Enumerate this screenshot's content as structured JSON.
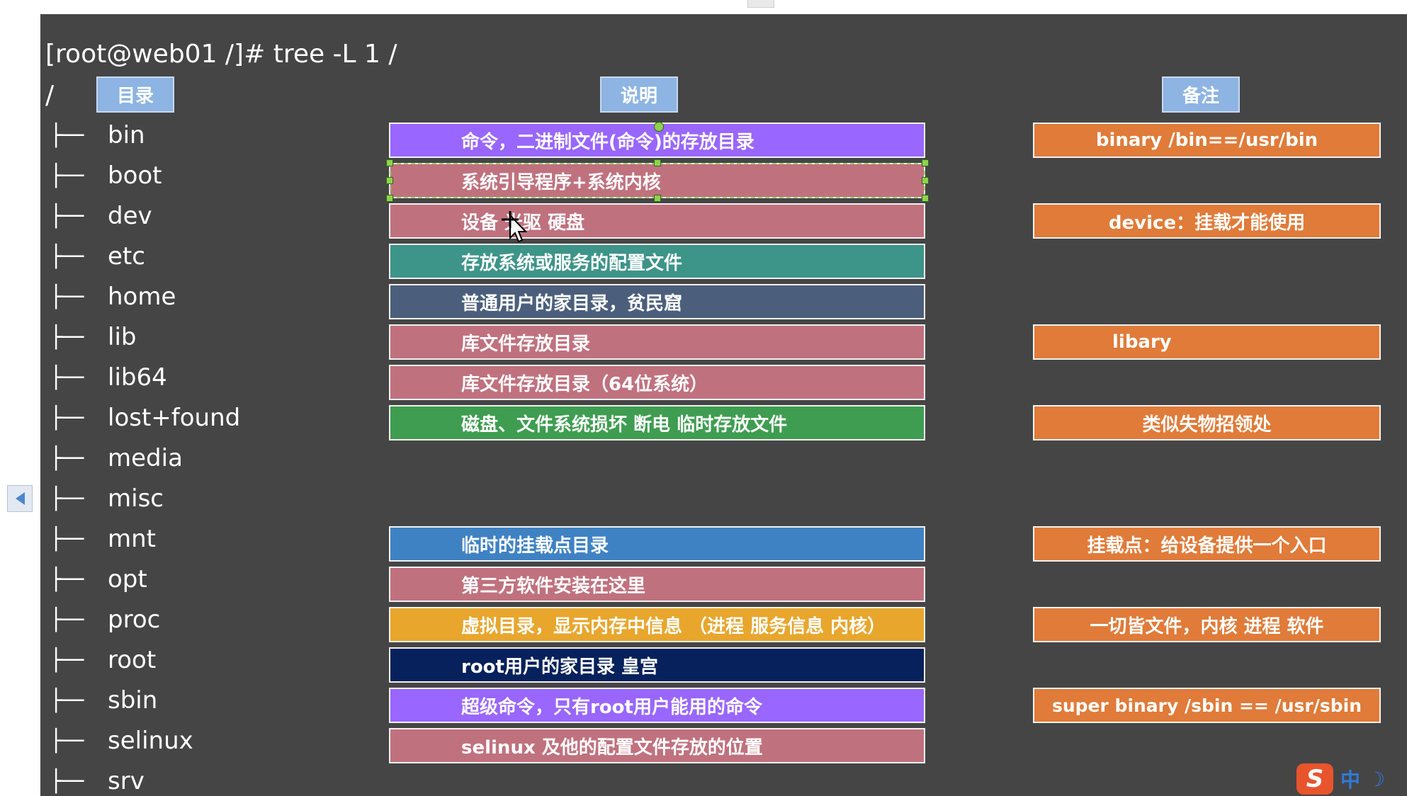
{
  "command": "[root@web01 /]# tree -L 1 /",
  "root": "/",
  "headers": {
    "dir": "目录",
    "desc": "说明",
    "note": "备注"
  },
  "tree_branch": "├──",
  "tree": [
    "bin",
    "boot",
    "dev",
    "etc",
    "home",
    "lib",
    "lib64",
    "lost+found",
    "media",
    "misc",
    "mnt",
    "opt",
    "proc",
    "root",
    "sbin",
    "selinux",
    "srv"
  ],
  "descriptions": [
    {
      "text": "命令，二进制文件(命令)的存放目录",
      "color": "#9966ff"
    },
    {
      "text": "系统引导程序+系统内核",
      "color": "#c0717e"
    },
    {
      "text": "设备 光驱 硬盘",
      "color": "#c0717e"
    },
    {
      "text": "存放系统或服务的配置文件",
      "color": "#3d9489"
    },
    {
      "text": "普通用户的家目录，贫民窟",
      "color": "#4b5f7d"
    },
    {
      "text": "库文件存放目录",
      "color": "#c0717e"
    },
    {
      "text": "库文件存放目录（64位系统）",
      "color": "#c0717e"
    },
    {
      "text": "磁盘、文件系统损坏 断电 临时存放文件",
      "color": "#3e9d50"
    },
    {
      "text": "临时的挂载点目录",
      "color": "#3f82c4"
    },
    {
      "text": "第三方软件安装在这里",
      "color": "#c0717e"
    },
    {
      "text": "虚拟目录，显示内存中信息 （进程 服务信息 内核）",
      "color": "#e8a62d"
    },
    {
      "text": "root用户的家目录 皇宫",
      "color": "#06215b"
    },
    {
      "text": "超级命令，只有root用户能用的命令",
      "color": "#9966ff"
    },
    {
      "text": "selinux 及他的配置文件存放的位置",
      "color": "#c0717e"
    }
  ],
  "notes": [
    {
      "text": "binary /bin==/usr/bin"
    },
    {
      "text": "device：挂载才能使用"
    },
    {
      "text": "libary"
    },
    {
      "text": "类似失物招领处"
    },
    {
      "text": "挂载点：给设备提供一个入口"
    },
    {
      "text": "一切皆文件，内核 进程 软件"
    },
    {
      "text": "super  binary /sbin  ==  /usr/sbin"
    }
  ],
  "ime": {
    "logo": "S",
    "mode": "中",
    "moon": "☽"
  }
}
